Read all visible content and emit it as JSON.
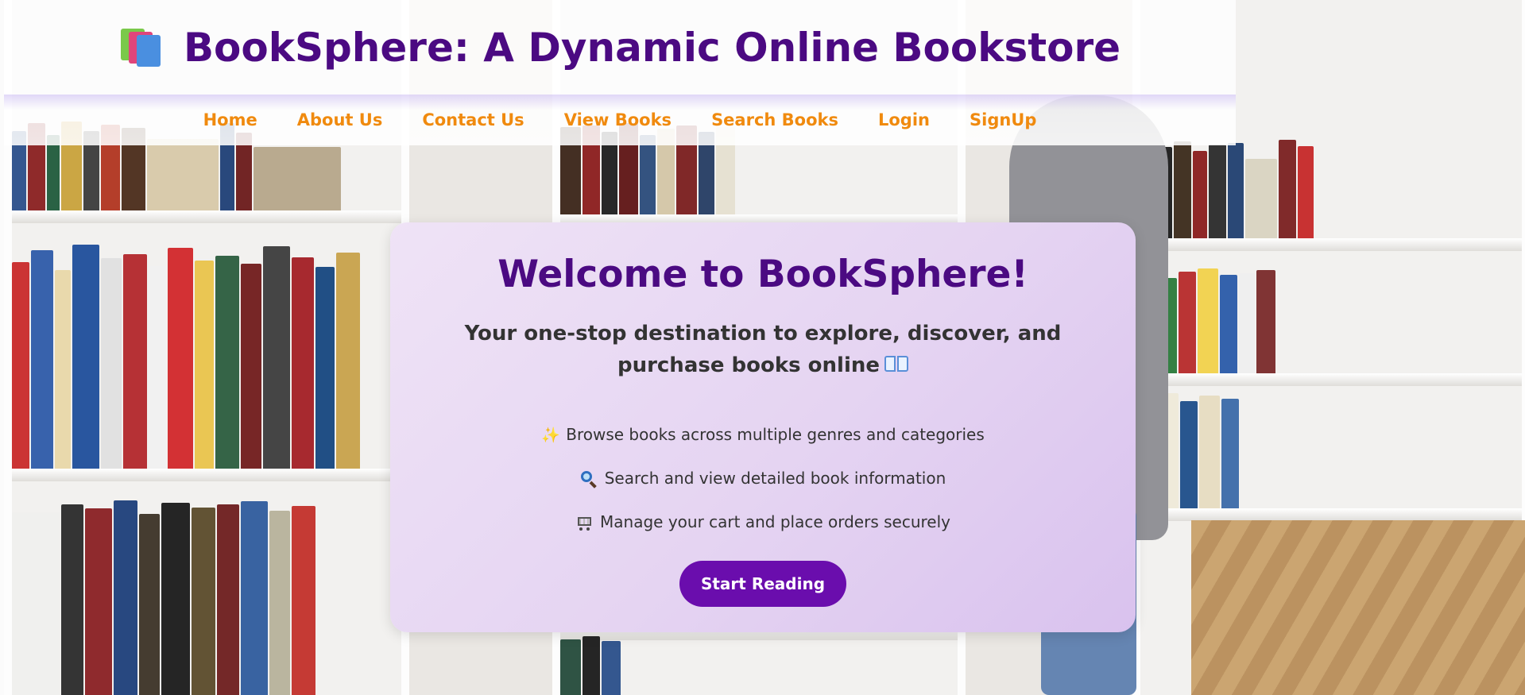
{
  "header": {
    "title": "BookSphere: A Dynamic Online Bookstore",
    "title_icon": "books-icon"
  },
  "nav": {
    "items": [
      {
        "label": "Home"
      },
      {
        "label": "About Us"
      },
      {
        "label": "Contact Us"
      },
      {
        "label": "View Books"
      },
      {
        "label": "Search Books"
      },
      {
        "label": "Login"
      },
      {
        "label": "SignUp"
      }
    ]
  },
  "hero": {
    "heading": "Welcome to BookSphere!",
    "subtitle": "Your one-stop destination to explore, discover, and purchase books online",
    "subtitle_icon": "open-book-icon",
    "features": [
      {
        "icon": "sparkles-icon",
        "text": "Browse books across multiple genres and categories"
      },
      {
        "icon": "magnifier-icon",
        "text": "Search and view detailed book information"
      },
      {
        "icon": "shopping-cart-icon",
        "text": "Manage your cart and place orders securely"
      }
    ],
    "cta_label": "Start Reading"
  },
  "colors": {
    "brand_purple": "#4b0a82",
    "nav_orange": "#f08a0e",
    "button_purple": "#6a0dad",
    "card_lavender": "#e5d4f2"
  }
}
